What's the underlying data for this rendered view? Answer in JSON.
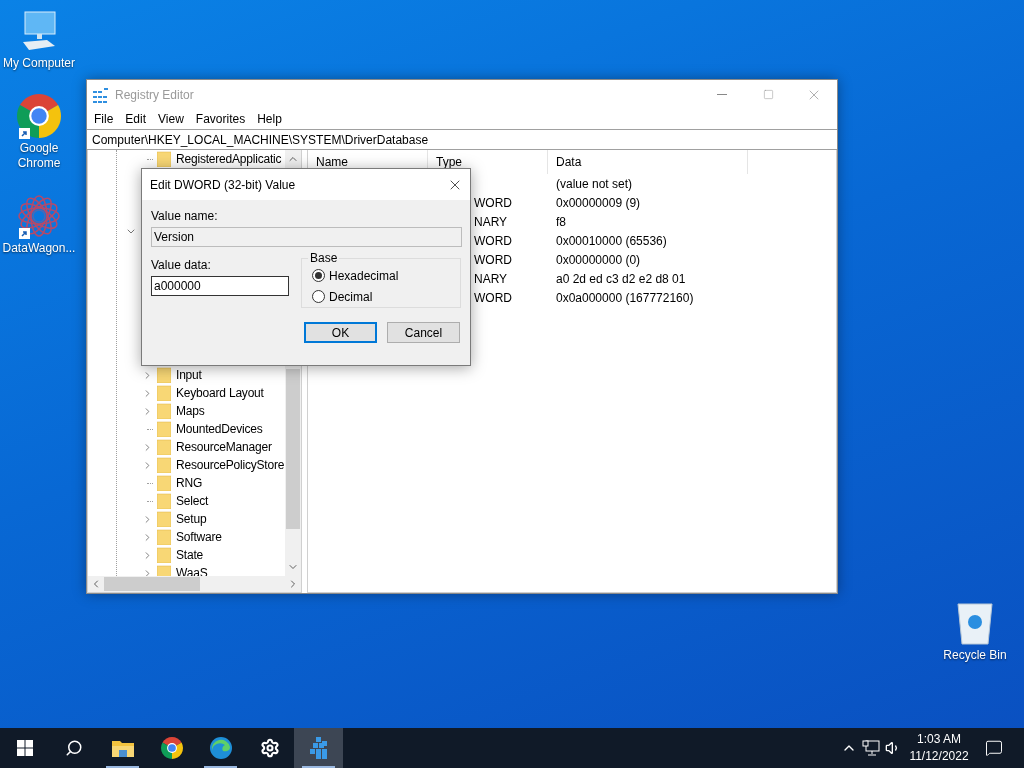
{
  "desktop_icons": [
    {
      "label": "My Computer",
      "kind": "computer"
    },
    {
      "label": "Google Chrome",
      "kind": "chrome",
      "shortcut": true
    },
    {
      "label": "DataWagon...",
      "kind": "datawagon",
      "shortcut": true
    }
  ],
  "recycle_bin": {
    "label": "Recycle Bin"
  },
  "registry_editor": {
    "title": "Registry Editor",
    "active": false,
    "menu": [
      "File",
      "Edit",
      "View",
      "Favorites",
      "Help"
    ],
    "address": "Computer\\HKEY_LOCAL_MACHINE\\SYSTEM\\DriverDatabase",
    "tree": [
      {
        "label": "RegisteredApplicatic",
        "has_children": false
      },
      {
        "expanded": true,
        "children": [
          {
            "label": "Input",
            "has_children": true
          },
          {
            "label": "Keyboard Layout",
            "has_children": true
          },
          {
            "label": "Maps",
            "has_children": true
          },
          {
            "label": "MountedDevices",
            "has_children": false
          },
          {
            "label": "ResourceManager",
            "has_children": true
          },
          {
            "label": "ResourcePolicyStore",
            "has_children": true
          },
          {
            "label": "RNG",
            "has_children": false
          },
          {
            "label": "Select",
            "has_children": false
          },
          {
            "label": "Setup",
            "has_children": true
          },
          {
            "label": "Software",
            "has_children": true
          },
          {
            "label": "State",
            "has_children": true
          },
          {
            "label": "WaaS",
            "has_children": true
          }
        ]
      }
    ],
    "list": {
      "columns": [
        "Name",
        "Type",
        "Data"
      ],
      "rows": [
        {
          "data": "(value not set)"
        },
        {
          "type": "WORD",
          "data": "0x00000009 (9)"
        },
        {
          "type": "NARY",
          "data": "f8"
        },
        {
          "type": "WORD",
          "data": "0x00010000 (65536)"
        },
        {
          "type": "WORD",
          "data": "0x00000000 (0)"
        },
        {
          "type": "NARY",
          "data": "a0 2d ed c3 d2 e2 d8 01"
        },
        {
          "type": "WORD",
          "data": "0x0a000000 (167772160)"
        }
      ]
    }
  },
  "dialog": {
    "title": "Edit DWORD (32-bit) Value",
    "value_name_label": "Value name:",
    "value_name": "Version",
    "value_name_read_only": true,
    "value_data_label": "Value data:",
    "value_data": "a000000",
    "base": {
      "label": "Base",
      "options": [
        {
          "label": "Hexadecimal",
          "selected": true
        },
        {
          "label": "Decimal",
          "selected": false
        }
      ]
    },
    "buttons": [
      {
        "label": "OK",
        "default": true
      },
      {
        "label": "Cancel",
        "default": false
      }
    ]
  },
  "taskbar": {
    "items": [
      {
        "kind": "start",
        "active": false,
        "running": false
      },
      {
        "kind": "search",
        "active": false,
        "running": false
      },
      {
        "kind": "explorer",
        "active": false,
        "running": true
      },
      {
        "kind": "chrome",
        "active": false,
        "running": false
      },
      {
        "kind": "edge",
        "active": false,
        "running": true
      },
      {
        "kind": "settings",
        "active": false,
        "running": false
      },
      {
        "kind": "regedit",
        "active": true,
        "running": true
      }
    ],
    "time": "1:03 AM",
    "date": "11/12/2022"
  }
}
